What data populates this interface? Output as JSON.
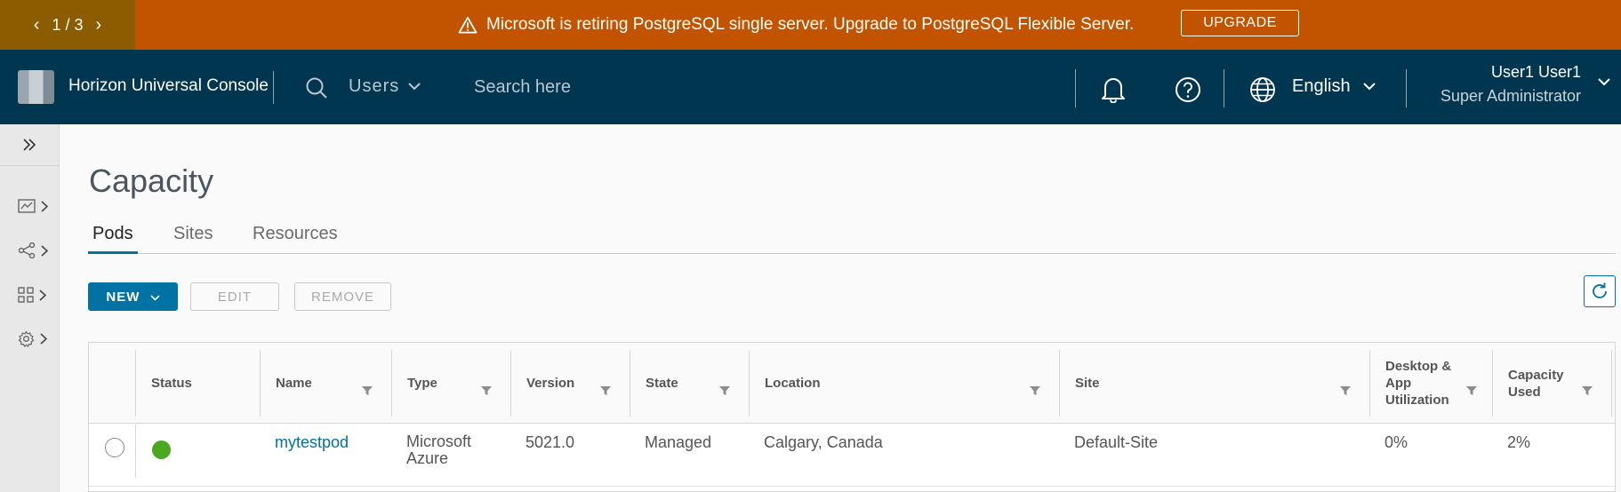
{
  "banner": {
    "pager_current": "1",
    "pager_total": "3",
    "pager_sep": "/",
    "message": "Microsoft is retiring PostgreSQL single server. Upgrade to PostgreSQL Flexible Server.",
    "upgrade_label": "UPGRADE",
    "icon": "warning-icon",
    "bg_color": "#c25400"
  },
  "header": {
    "app_title": "Horizon Universal Console",
    "search_scope": "Users",
    "search_placeholder": "Search here",
    "language": "English",
    "user_name": "User1 User1",
    "user_role": "Super Administrator",
    "bg_color": "#00364f"
  },
  "sidebar": {
    "items": [
      {
        "icon": "monitor-chart-icon"
      },
      {
        "icon": "share-nodes-icon"
      },
      {
        "icon": "grid-apps-icon"
      },
      {
        "icon": "gear-icon"
      }
    ]
  },
  "main": {
    "title": "Capacity",
    "tabs": [
      {
        "label": "Pods",
        "active": true
      },
      {
        "label": "Sites",
        "active": false
      },
      {
        "label": "Resources",
        "active": false
      }
    ],
    "toolbar": {
      "new_label": "NEW",
      "edit_label": "EDIT",
      "remove_label": "REMOVE"
    },
    "accent_color": "#0072a3"
  },
  "grid": {
    "columns": [
      "Status",
      "Name",
      "Type",
      "Version",
      "State",
      "Location",
      "Site",
      "Desktop & App Utilization",
      "Capacity Used"
    ],
    "rows": [
      {
        "status": "green",
        "name": "mytestpod",
        "type": "Microsoft Azure",
        "version": "5021.0",
        "state": "Managed",
        "location": "Calgary, Canada",
        "site": "Default-Site",
        "utilization": "0%",
        "capacity_used": "2%"
      }
    ]
  }
}
